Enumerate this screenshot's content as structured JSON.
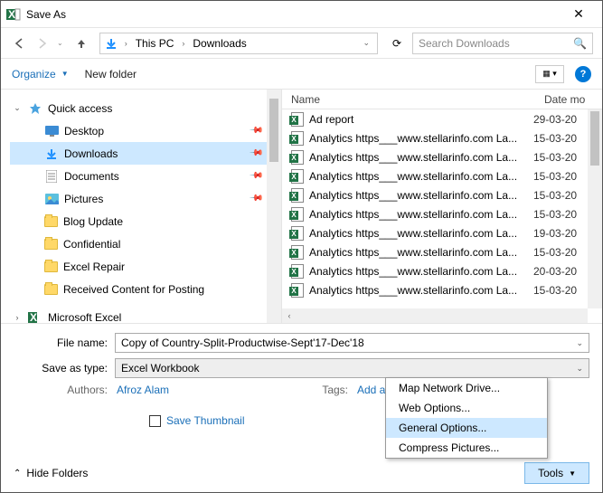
{
  "window": {
    "title": "Save As"
  },
  "nav": {
    "crumb1": "This PC",
    "crumb2": "Downloads",
    "search_placeholder": "Search Downloads"
  },
  "toolbar": {
    "organize": "Organize",
    "new_folder": "New folder"
  },
  "tree": {
    "quick_access": "Quick access",
    "desktop": "Desktop",
    "downloads": "Downloads",
    "documents": "Documents",
    "pictures": "Pictures",
    "blog_update": "Blog Update",
    "confidential": "Confidential",
    "excel_repair": "Excel Repair",
    "received": "Received Content for Posting",
    "ms_excel": "Microsoft Excel"
  },
  "list": {
    "col_name": "Name",
    "col_date": "Date mo",
    "rows": [
      {
        "name": "Ad report",
        "date": "29-03-20"
      },
      {
        "name": "Analytics https___www.stellarinfo.com La...",
        "date": "15-03-20"
      },
      {
        "name": "Analytics https___www.stellarinfo.com La...",
        "date": "15-03-20"
      },
      {
        "name": "Analytics https___www.stellarinfo.com La...",
        "date": "15-03-20"
      },
      {
        "name": "Analytics https___www.stellarinfo.com La...",
        "date": "15-03-20"
      },
      {
        "name": "Analytics https___www.stellarinfo.com La...",
        "date": "15-03-20"
      },
      {
        "name": "Analytics https___www.stellarinfo.com La...",
        "date": "19-03-20"
      },
      {
        "name": "Analytics https___www.stellarinfo.com La...",
        "date": "15-03-20"
      },
      {
        "name": "Analytics https___www.stellarinfo.com La...",
        "date": "20-03-20"
      },
      {
        "name": "Analytics https___www.stellarinfo.com La...",
        "date": "15-03-20"
      }
    ]
  },
  "form": {
    "filename_label": "File name:",
    "filename_value": "Copy of Country-Split-Productwise-Sept'17-Dec'18",
    "type_label": "Save as type:",
    "type_value": "Excel Workbook",
    "authors_label": "Authors:",
    "authors_value": "Afroz Alam",
    "tags_label": "Tags:",
    "tags_value": "Add a tag",
    "save_thumb": "Save Thumbnail"
  },
  "footer": {
    "hide_folders": "Hide Folders",
    "tools": "Tools"
  },
  "menu": {
    "map": "Map Network Drive...",
    "web": "Web Options...",
    "general": "General Options...",
    "compress": "Compress Pictures..."
  }
}
